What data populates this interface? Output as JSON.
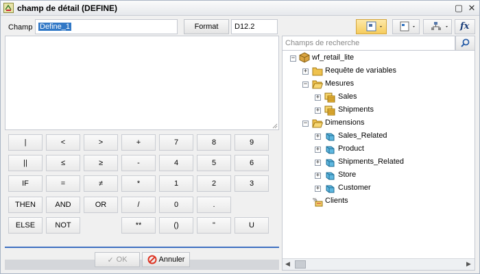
{
  "window": {
    "title": "champ de détail (DEFINE)"
  },
  "form": {
    "champ_label": "Champ",
    "champ_value": "Define_1",
    "format_button": "Format",
    "format_value": "D12.2"
  },
  "keypad": [
    [
      "|",
      "<",
      ">",
      "+",
      "7",
      "8",
      "9"
    ],
    [
      "||",
      "≤",
      "≥",
      "-",
      "4",
      "5",
      "6"
    ],
    [
      "IF",
      "=",
      "≠",
      "*",
      "1",
      "2",
      "3"
    ],
    [
      "THEN",
      "AND",
      "OR",
      "/",
      "0",
      ".",
      ""
    ],
    [
      "ELSE",
      "NOT",
      "",
      "**",
      "()",
      "\"",
      "U"
    ]
  ],
  "footer": {
    "ok_label": "OK",
    "cancel_label": "Annuler"
  },
  "search": {
    "placeholder": "Champs de recherche"
  },
  "tree": {
    "root": "wf_retail_lite",
    "items": {
      "requete": "Requête de variables",
      "mesures": "Mesures",
      "sales": "Sales",
      "shipments": "Shipments",
      "dimensions": "Dimensions",
      "sales_related": "Sales_Related",
      "product": "Product",
      "shipments_related": "Shipments_Related",
      "store": "Store",
      "customer": "Customer",
      "clients": "Clients"
    }
  },
  "colors": {
    "accent": "#3c6ec0",
    "selection": "#3178c6",
    "folder": "#e8b84a"
  }
}
